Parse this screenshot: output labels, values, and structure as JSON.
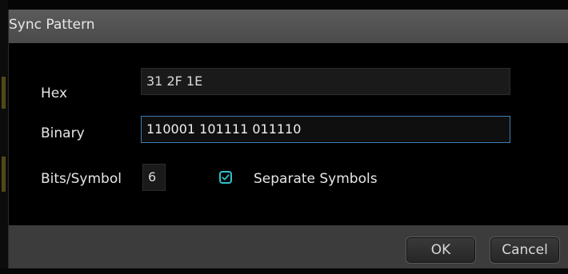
{
  "dialog": {
    "title": "Sync Pattern",
    "hex": {
      "label": "Hex",
      "value": "31 2F 1E"
    },
    "binary": {
      "label": "Binary",
      "value": "110001 101111 011110"
    },
    "bits_per_symbol": {
      "label": "Bits/Symbol",
      "value": "6"
    },
    "separate_symbols": {
      "label": "Separate Symbols",
      "checked": true
    },
    "buttons": {
      "ok": "OK",
      "cancel": "Cancel"
    }
  },
  "colors": {
    "accent": "#2fc0cf",
    "focus_border": "#3d7fb5",
    "titlebar": "#555555",
    "footer": "#3c3c3c"
  },
  "icons": {
    "checkbox": "checkmark-icon"
  }
}
